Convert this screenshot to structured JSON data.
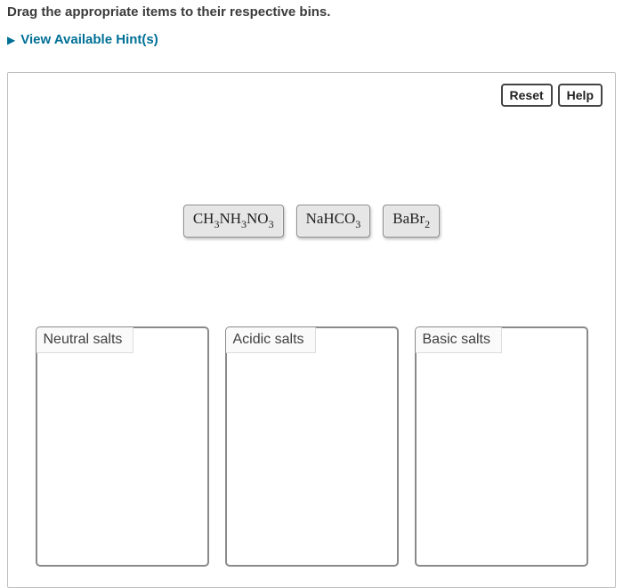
{
  "instruction": "Drag the appropriate items to their respective bins.",
  "hints_link": "View Available Hint(s)",
  "buttons": {
    "reset": "Reset",
    "help": "Help"
  },
  "items": [
    {
      "formula": "CH3NH3NO3"
    },
    {
      "formula": "NaHCO3"
    },
    {
      "formula": "BaBr2"
    }
  ],
  "bins": [
    {
      "label": "Neutral salts"
    },
    {
      "label": "Acidic salts"
    },
    {
      "label": "Basic salts"
    }
  ]
}
